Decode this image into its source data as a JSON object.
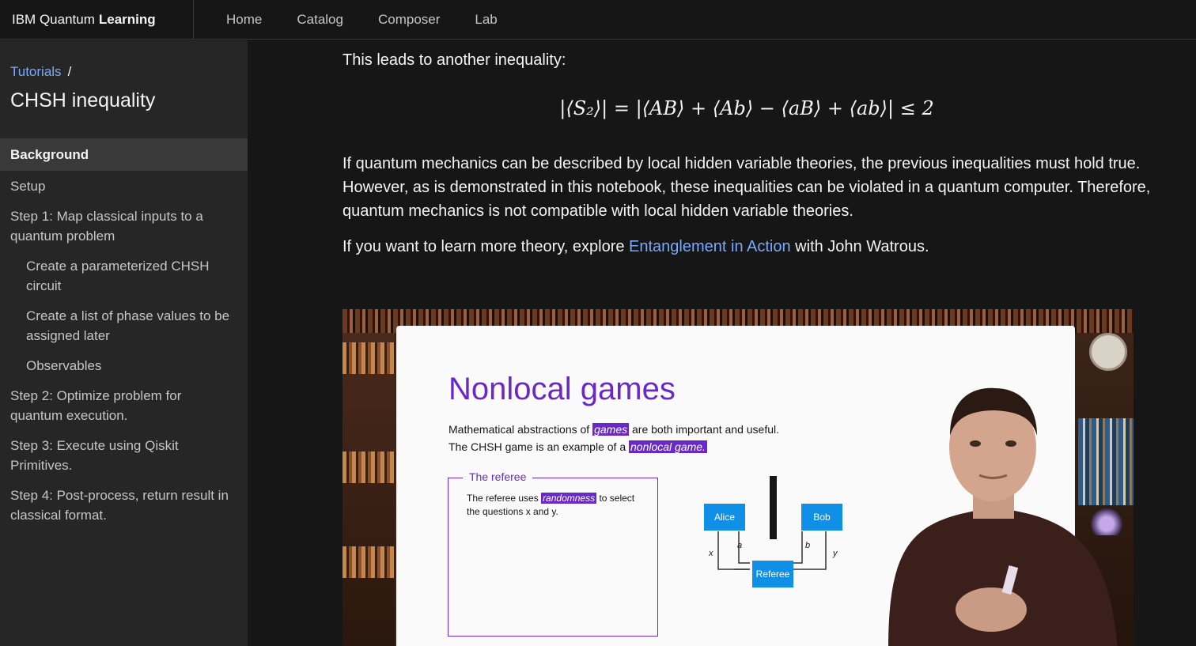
{
  "header": {
    "brand_prefix": "IBM Quantum",
    "brand_bold": "Learning",
    "nav": [
      "Home",
      "Catalog",
      "Composer",
      "Lab"
    ]
  },
  "sidebar": {
    "breadcrumb_link": "Tutorials",
    "breadcrumb_sep": "/",
    "title": "CHSH inequality",
    "toc": [
      {
        "label": "Background",
        "active": true,
        "level": 0
      },
      {
        "label": "Setup",
        "level": 0
      },
      {
        "label": "Step 1: Map classical inputs to a quantum problem",
        "level": 0
      },
      {
        "label": "Create a parameterized CHSH circuit",
        "level": 1
      },
      {
        "label": "Create a list of phase values to be assigned later",
        "level": 1
      },
      {
        "label": "Observables",
        "level": 1
      },
      {
        "label": "Step 2: Optimize problem for quantum execution.",
        "level": 0
      },
      {
        "label": "Step 3: Execute using Qiskit Primitives.",
        "level": 0
      },
      {
        "label": "Step 4: Post-process, return result in classical format.",
        "level": 0
      }
    ]
  },
  "content": {
    "intro": "This leads to another inequality:",
    "equation": "|⟨S₂⟩| = |⟨AB⟩ + ⟨Ab⟩ − ⟨aB⟩ + ⟨ab⟩| ≤ 2",
    "para1": "If quantum mechanics can be described by local hidden variable theories, the previous inequalities must hold true. However, as is demonstrated in this notebook, these inequalities can be violated in a quantum computer. Therefore, quantum mechanics is not compatible with local hidden variable theories.",
    "para2_before": "If you want to learn more theory, explore ",
    "para2_link": "Entanglement in Action",
    "para2_after": " with John Watrous."
  },
  "video": {
    "slide_title": "Nonlocal games",
    "line1_before": "Mathematical abstractions of ",
    "line1_hl": "games",
    "line1_after": " are both important and useful.",
    "line2_before": "The CHSH game is an example of a ",
    "line2_hl": "nonlocal game.",
    "referee_legend": "The referee",
    "referee_before": "The referee uses ",
    "referee_hl": "randomness",
    "referee_after": " to select",
    "referee_line2": "the questions x and y.",
    "alice": "Alice",
    "bob": "Bob",
    "referee": "Referee",
    "lbl_x": "x",
    "lbl_a": "a",
    "lbl_b": "b",
    "lbl_y": "y"
  },
  "colors": {
    "link": "#78a9ff",
    "accent_purple": "#6929c4",
    "diagram_blue": "#0f8fe6"
  }
}
